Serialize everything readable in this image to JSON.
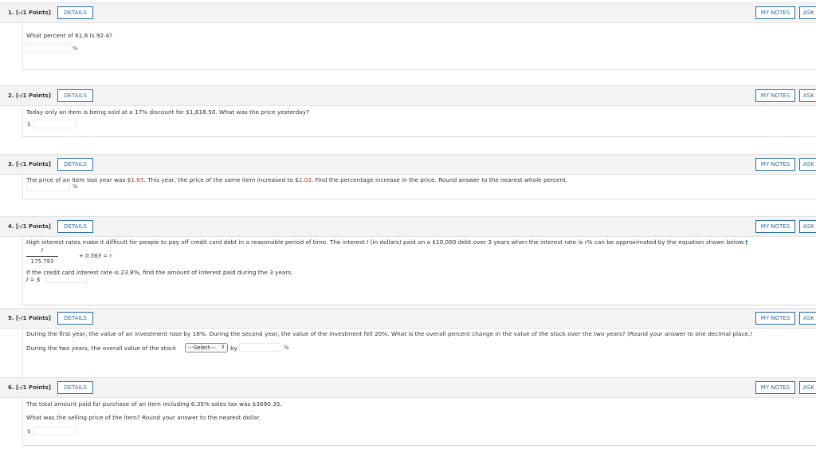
{
  "labels": {
    "details": "DETAILS",
    "my_notes": "MY NOTES",
    "ask": "ASK"
  },
  "q1": {
    "number": "1.  [-/1 Points]",
    "text": "What percent of 61.6 is 92.4?",
    "unit": "%"
  },
  "q2": {
    "number": "2.  [-/1 Points]",
    "text": "Today only an item is being sold at a 17% discount for $1,618.50. What was the price yesterday?",
    "prefix": "$"
  },
  "q3": {
    "number": "3.  [-/1 Points]",
    "text_a": "The price of an item last year was $",
    "val_a": "1.65",
    "text_b": ". This year, the price of the same item increased to $",
    "val_b": "2.03",
    "text_c": ". Find the percentage increase in the price. Round answer to the nearest whole percent.",
    "unit": "%"
  },
  "q4": {
    "number": "4.  [-/1 Points]",
    "text_a": "High interest rates make it difficult for people to pay off credit card debt in a reasonable period of time. The interest ",
    "var_i": "I",
    "text_b": " (in dollars) paid on a $10,000 debt over 3 years when the interest rate is ",
    "var_r": "r",
    "text_c": "% can be approximated by the equation shown below.",
    "dagger": "†",
    "eq_num": "I",
    "eq_den": "175.793",
    "eq_rest": "+ 0.563 = r",
    "text_d": "If the credit card interest rate is 23.8%, find the amount of interest paid during the 3 years.",
    "answer_label": "I = $"
  },
  "q5": {
    "number": "5.  [-/1 Points]",
    "text": "During the first year, the value of an investment rose by 18%. During the second year, the value of the investment fell 20%. What is the overall percent change in the value of the stock over the two years? (Round your answer to one decimal place.)",
    "answer_prefix": "During the two years, the overall value of the stock",
    "select_value": "---Select---",
    "by": "by",
    "unit": "%"
  },
  "q6": {
    "number": "6.  [-/1 Points]",
    "text_a": "The total amount paid for purchase of an item including 6.35% sales tax was $3690.35.",
    "text_b": "What was the selling price of the item? Round your answer to the nearest dollar.",
    "prefix": "$"
  },
  "colors": {
    "accent": "#2e6fa8",
    "highlight": "#c0392b",
    "header_bg": "#f3f3f3"
  }
}
